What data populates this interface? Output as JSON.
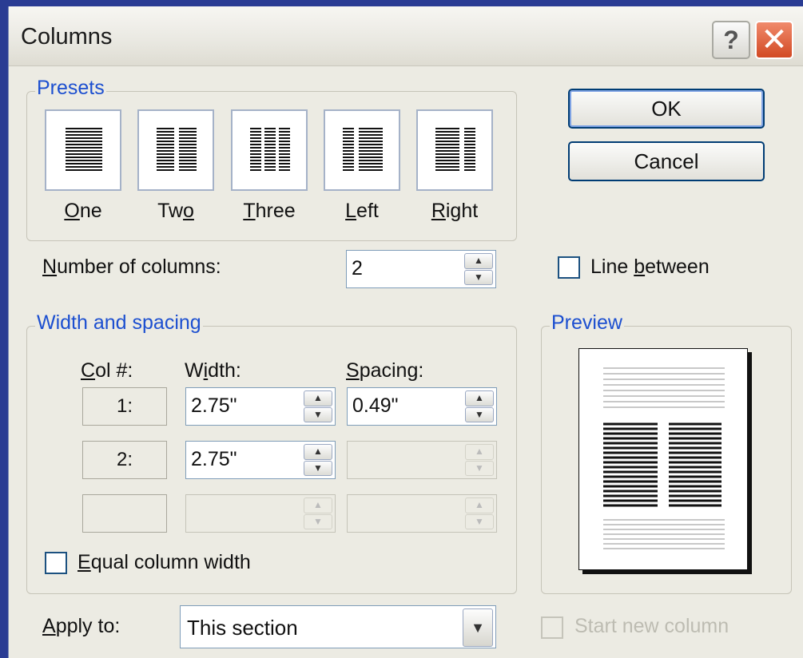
{
  "dialog": {
    "title": "Columns",
    "help_glyph": "?",
    "close_glyph": "✕"
  },
  "presets": {
    "label": "Presets",
    "items": [
      {
        "key": "O",
        "rest": "ne"
      },
      {
        "pre": "Tw",
        "key": "o",
        "rest": ""
      },
      {
        "pre": "",
        "key": "T",
        "rest": "hree"
      },
      {
        "pre": "",
        "key": "L",
        "rest": "eft"
      },
      {
        "pre": "",
        "key": "R",
        "rest": "ight"
      }
    ]
  },
  "buttons": {
    "ok": "OK",
    "cancel": "Cancel"
  },
  "number_of_columns": {
    "key": "N",
    "rest": "umber of columns:",
    "value": "2"
  },
  "line_between": {
    "pre": "Line ",
    "key": "b",
    "rest": "etween",
    "checked": false
  },
  "width_spacing": {
    "label": "Width and spacing",
    "col_header_key": "C",
    "col_header_rest": "ol #:",
    "width_header_pre": "W",
    "width_header_key": "i",
    "width_header_rest": "dth:",
    "spacing_header_key": "S",
    "spacing_header_rest": "pacing:",
    "rows": [
      {
        "col": "1:",
        "width": "2.75\"",
        "spacing": "0.49\""
      },
      {
        "col": "2:",
        "width": "2.75\"",
        "spacing": ""
      },
      {
        "col": "",
        "width": "",
        "spacing": ""
      }
    ]
  },
  "equal_width": {
    "key": "E",
    "rest": "qual column width",
    "checked": false
  },
  "preview": {
    "label": "Preview"
  },
  "apply_to": {
    "key": "A",
    "rest": "pply to:",
    "value": "This section"
  },
  "start_new_column": {
    "label": "Start new column",
    "checked": false,
    "enabled": false
  },
  "colors": {
    "group_label": "#1c4fd0",
    "dialog_bg": "#ecebe3",
    "desktop_bg": "#2a3c93"
  }
}
